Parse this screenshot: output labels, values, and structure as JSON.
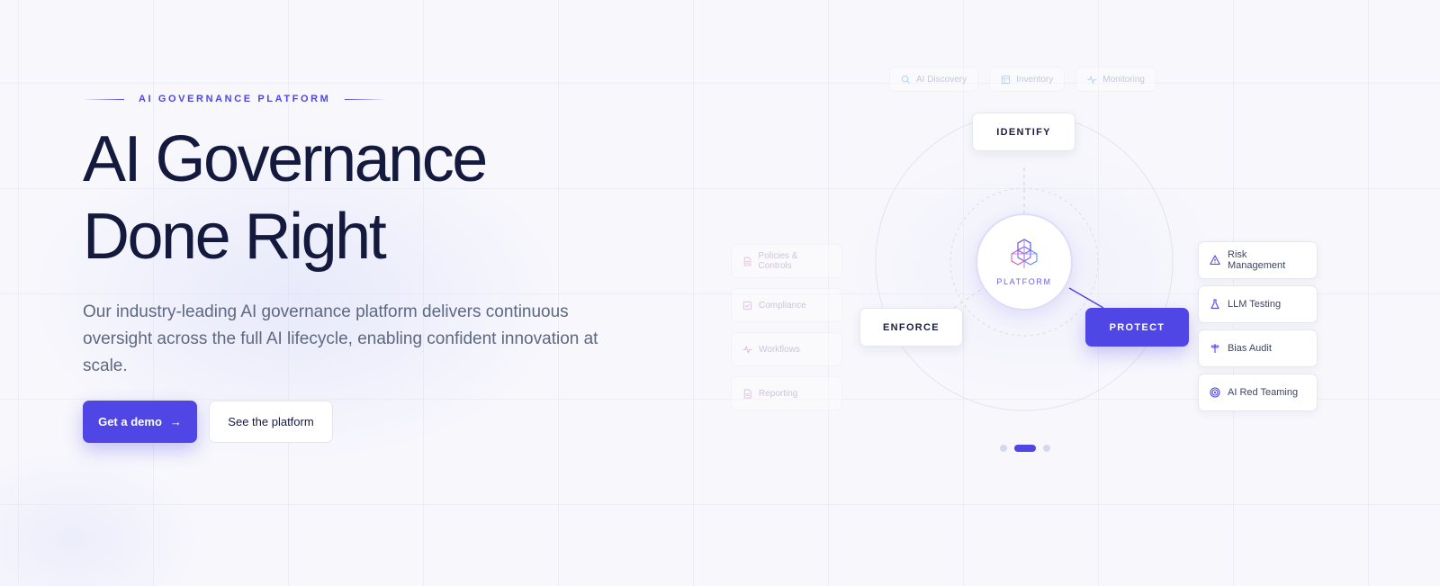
{
  "hero": {
    "eyebrow": "AI GOVERNANCE PLATFORM",
    "headline_line1": "AI Governance",
    "headline_line2": "Done Right",
    "subtext": "Our industry-leading AI governance platform delivers continuous oversight across the full AI lifecycle, enabling confident innovation at scale.",
    "primary_cta": "Get a demo",
    "secondary_cta": "See the platform"
  },
  "diagram": {
    "top_tabs": [
      {
        "label": "AI Discovery",
        "icon": "search-icon"
      },
      {
        "label": "Inventory",
        "icon": "table-icon"
      },
      {
        "label": "Monitoring",
        "icon": "pulse-icon"
      }
    ],
    "left_items": [
      {
        "label": "Policies & Controls",
        "icon": "document-icon"
      },
      {
        "label": "Compliance",
        "icon": "check-square-icon"
      },
      {
        "label": "Workflows",
        "icon": "pulse-icon"
      },
      {
        "label": "Reporting",
        "icon": "document-icon"
      }
    ],
    "nodes": {
      "identify": "IDENTIFY",
      "enforce": "ENFORCE",
      "protect": "PROTECT"
    },
    "center_label": "PLATFORM",
    "capabilities": [
      {
        "label": "Risk Management",
        "icon": "warning-icon"
      },
      {
        "label": "LLM Testing",
        "icon": "flask-icon"
      },
      {
        "label": "Bias Audit",
        "icon": "balance-icon"
      },
      {
        "label": "AI Red Teaming",
        "icon": "target-icon"
      }
    ],
    "active_slide": 2,
    "slide_count": 3
  },
  "colors": {
    "accent": "#4f46e5",
    "headline": "#141a3d",
    "body_text": "#5e6880",
    "background": "#f7f7fc"
  }
}
